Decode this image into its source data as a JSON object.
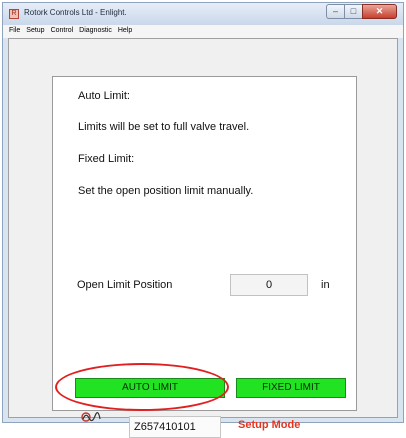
{
  "window": {
    "title": "Rotork Controls Ltd - Enlight.",
    "app_icon": "rotork-app-icon",
    "controls": {
      "minimize": "–",
      "maximize": "□",
      "close": "✕"
    }
  },
  "menu": {
    "items": [
      "File",
      "Setup",
      "Control",
      "Diagnostic",
      "Help"
    ]
  },
  "panel": {
    "auto_limit_heading": "Auto Limit:",
    "auto_limit_desc": "Limits will be set to full valve travel.",
    "fixed_limit_heading": "Fixed Limit:",
    "fixed_limit_desc": "Set the open position limit manually.",
    "open_limit_label": "Open Limit Position",
    "open_limit_value": "0",
    "open_limit_unit": "in",
    "auto_limit_button": "AUTO LIMIT",
    "fixed_limit_button": "FIXED LIMIT",
    "serial_number": "Z657410101",
    "mode": "Setup Mode"
  },
  "colors": {
    "button_green": "#22e322",
    "mode_red": "#e8341e",
    "highlight_ellipse": "#e02020"
  },
  "icons": {
    "status": "signal-wave-icon"
  }
}
